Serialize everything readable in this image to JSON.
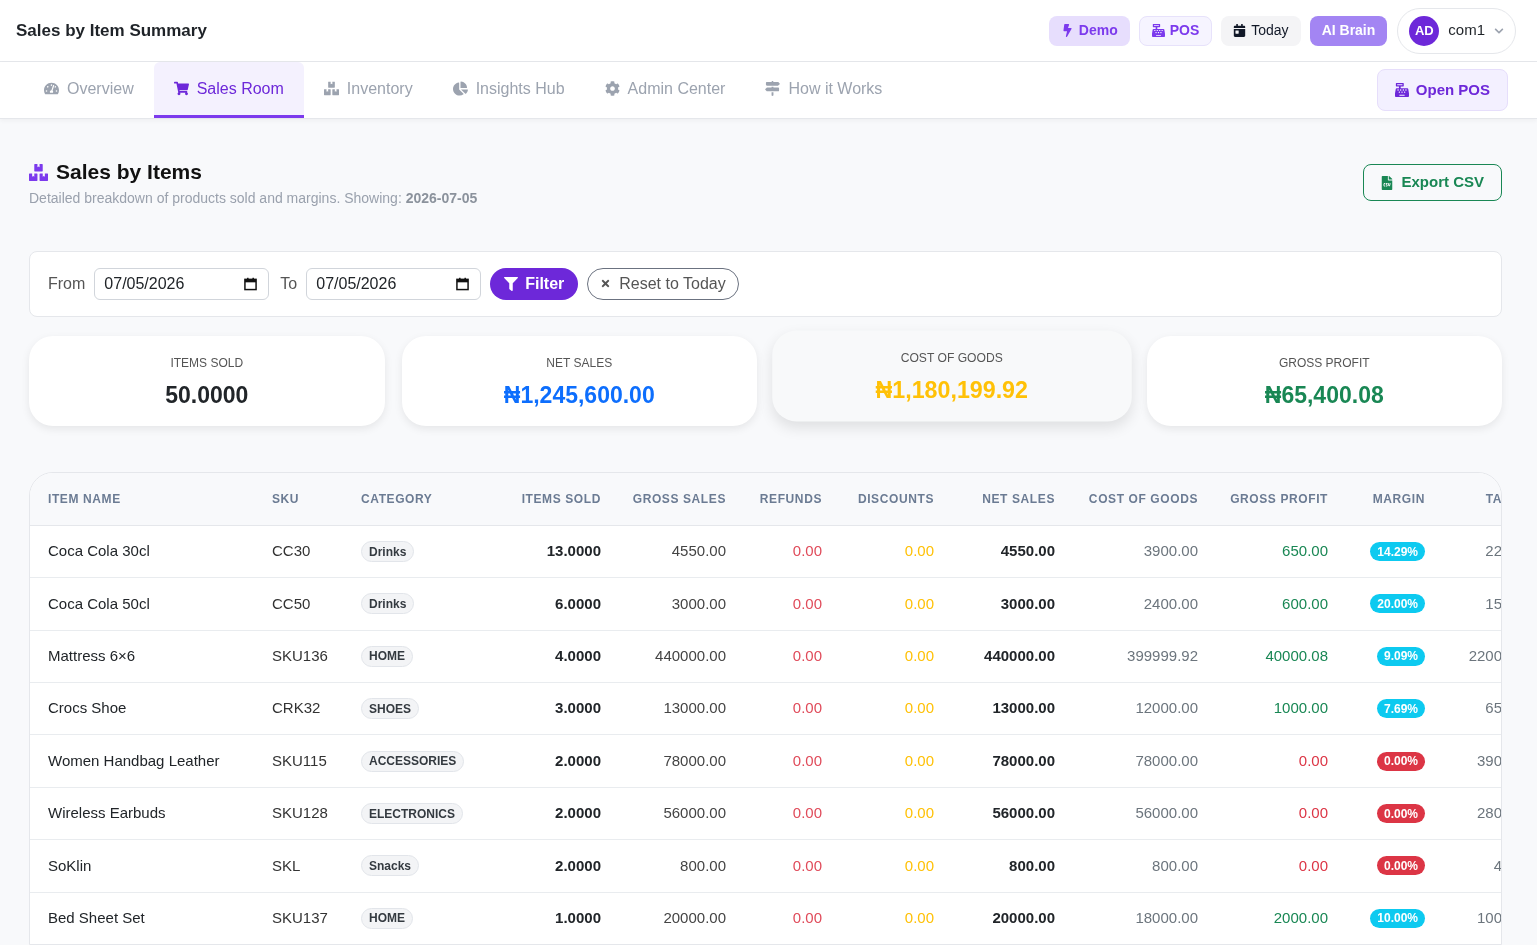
{
  "header": {
    "title": "Sales by Item Summary",
    "buttons": [
      {
        "kind": "demo",
        "label": "Demo"
      },
      {
        "kind": "pos",
        "label": "POS"
      },
      {
        "kind": "today",
        "label": "Today"
      },
      {
        "kind": "ai",
        "label": "AI Brain"
      }
    ],
    "user": {
      "initials": "AD",
      "name": "com1"
    }
  },
  "nav": {
    "tabs": [
      {
        "label": "Overview",
        "selected": false
      },
      {
        "label": "Sales Room",
        "selected": true
      },
      {
        "label": "Inventory",
        "selected": false
      },
      {
        "label": "Insights Hub",
        "selected": false
      },
      {
        "label": "Admin Center",
        "selected": false
      },
      {
        "label": "How it Works",
        "selected": false
      }
    ],
    "action": "Open POS"
  },
  "page": {
    "title": "Sales by Items",
    "subtitle": "Detailed breakdown of products sold and margins. Showing: **2026-07-05**",
    "export_button": "Export CSV"
  },
  "filter": {
    "from_label": "From",
    "from_value": "07/05/2026",
    "to_label": "To",
    "to_value": "07/05/2026",
    "filter_button": "Filter",
    "reset_button": "Reset to Today"
  },
  "cards": [
    {
      "label": "ITEMS SOLD",
      "value": "50.0000",
      "color": "#212529",
      "hovered": false
    },
    {
      "label": "NET SALES",
      "value": "₦1,245,600.00",
      "color": "#0d6efd",
      "hovered": false
    },
    {
      "label": "COST OF GOODS",
      "value": "₦1,180,199.92",
      "color": "#ffc107",
      "hovered": true
    },
    {
      "label": "GROSS PROFIT",
      "value": "₦65,400.08",
      "color": "#198754",
      "hovered": false
    }
  ],
  "table": {
    "columns": [
      "ITEM NAME",
      "SKU",
      "CATEGORY",
      "ITEMS SOLD",
      "GROSS SALES",
      "REFUNDS",
      "DISCOUNTS",
      "NET SALES",
      "COST OF GOODS",
      "GROSS PROFIT",
      "MARGIN",
      "TA"
    ],
    "rows": [
      {
        "item_name": "Coca Cola 30cl",
        "sku": "CC30",
        "category": "Drinks",
        "items_sold": "13.0000",
        "gross_sales": "4550.00",
        "refunds": "0.00",
        "discounts": "0.00",
        "net_sales": "4550.00",
        "cost_of_goods": "3900.00",
        "gross_profit": {
          "text": "650.00",
          "color": "#198754"
        },
        "margin": {
          "text": "14.29%",
          "color": "#0dcaf0"
        },
        "column_12": "22"
      },
      {
        "item_name": "Coca Cola 50cl",
        "sku": "CC50",
        "category": "Drinks",
        "items_sold": "6.0000",
        "gross_sales": "3000.00",
        "refunds": "0.00",
        "discounts": "0.00",
        "net_sales": "3000.00",
        "cost_of_goods": "2400.00",
        "gross_profit": {
          "text": "600.00",
          "color": "#198754"
        },
        "margin": {
          "text": "20.00%",
          "color": "#0dcaf0"
        },
        "column_12": "15"
      },
      {
        "item_name": "Mattress 6×6",
        "sku": "SKU136",
        "category": "HOME",
        "items_sold": "4.0000",
        "gross_sales": "440000.00",
        "refunds": "0.00",
        "discounts": "0.00",
        "net_sales": "440000.00",
        "cost_of_goods": "399999.92",
        "gross_profit": {
          "text": "40000.08",
          "color": "#198754"
        },
        "margin": {
          "text": "9.09%",
          "color": "#0dcaf0"
        },
        "column_12": "2200"
      },
      {
        "item_name": "Crocs Shoe",
        "sku": "CRK32",
        "category": "SHOES",
        "items_sold": "3.0000",
        "gross_sales": "13000.00",
        "refunds": "0.00",
        "discounts": "0.00",
        "net_sales": "13000.00",
        "cost_of_goods": "12000.00",
        "gross_profit": {
          "text": "1000.00",
          "color": "#198754"
        },
        "margin": {
          "text": "7.69%",
          "color": "#0dcaf0"
        },
        "column_12": "65"
      },
      {
        "item_name": "Women Handbag Leather",
        "sku": "SKU115",
        "category": "ACCESSORIES",
        "items_sold": "2.0000",
        "gross_sales": "78000.00",
        "refunds": "0.00",
        "discounts": "0.00",
        "net_sales": "78000.00",
        "cost_of_goods": "78000.00",
        "gross_profit": {
          "text": "0.00",
          "color": "#dc3545"
        },
        "margin": {
          "text": "0.00%",
          "color": "#dc3545"
        },
        "column_12": "390"
      },
      {
        "item_name": "Wireless Earbuds",
        "sku": "SKU128",
        "category": "ELECTRONICS",
        "items_sold": "2.0000",
        "gross_sales": "56000.00",
        "refunds": "0.00",
        "discounts": "0.00",
        "net_sales": "56000.00",
        "cost_of_goods": "56000.00",
        "gross_profit": {
          "text": "0.00",
          "color": "#dc3545"
        },
        "margin": {
          "text": "0.00%",
          "color": "#dc3545"
        },
        "column_12": "280"
      },
      {
        "item_name": "SoKlin",
        "sku": "SKL",
        "category": "Snacks",
        "items_sold": "2.0000",
        "gross_sales": "800.00",
        "refunds": "0.00",
        "discounts": "0.00",
        "net_sales": "800.00",
        "cost_of_goods": "800.00",
        "gross_profit": {
          "text": "0.00",
          "color": "#dc3545"
        },
        "margin": {
          "text": "0.00%",
          "color": "#dc3545"
        },
        "column_12": "4"
      },
      {
        "item_name": "Bed Sheet Set",
        "sku": "SKU137",
        "category": "HOME",
        "items_sold": "1.0000",
        "gross_sales": "20000.00",
        "refunds": "0.00",
        "discounts": "0.00",
        "net_sales": "20000.00",
        "cost_of_goods": "18000.00",
        "gross_profit": {
          "text": "2000.00",
          "color": "#198754"
        },
        "margin": {
          "text": "10.00%",
          "color": "#0dcaf0"
        },
        "column_12": "100"
      }
    ]
  }
}
